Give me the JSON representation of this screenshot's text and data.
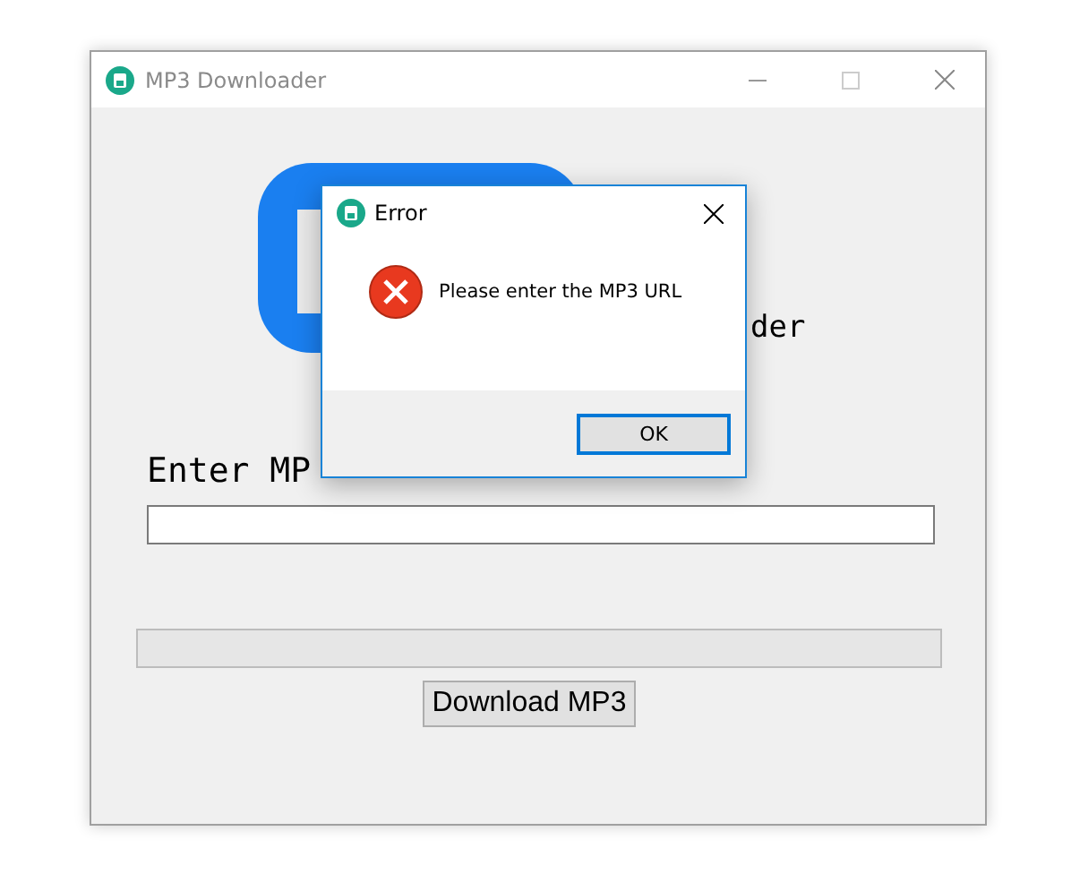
{
  "window": {
    "title": "MP3 Downloader"
  },
  "header": {
    "title_fragment": "der"
  },
  "url_label": "Enter MP",
  "progress": {
    "level": 0
  },
  "download_button": "Download MP3",
  "dialog": {
    "title": "Error",
    "message": "Please enter the MP3 URL",
    "buttons": [
      {
        "label": "OK",
        "selected": true
      }
    ]
  }
}
